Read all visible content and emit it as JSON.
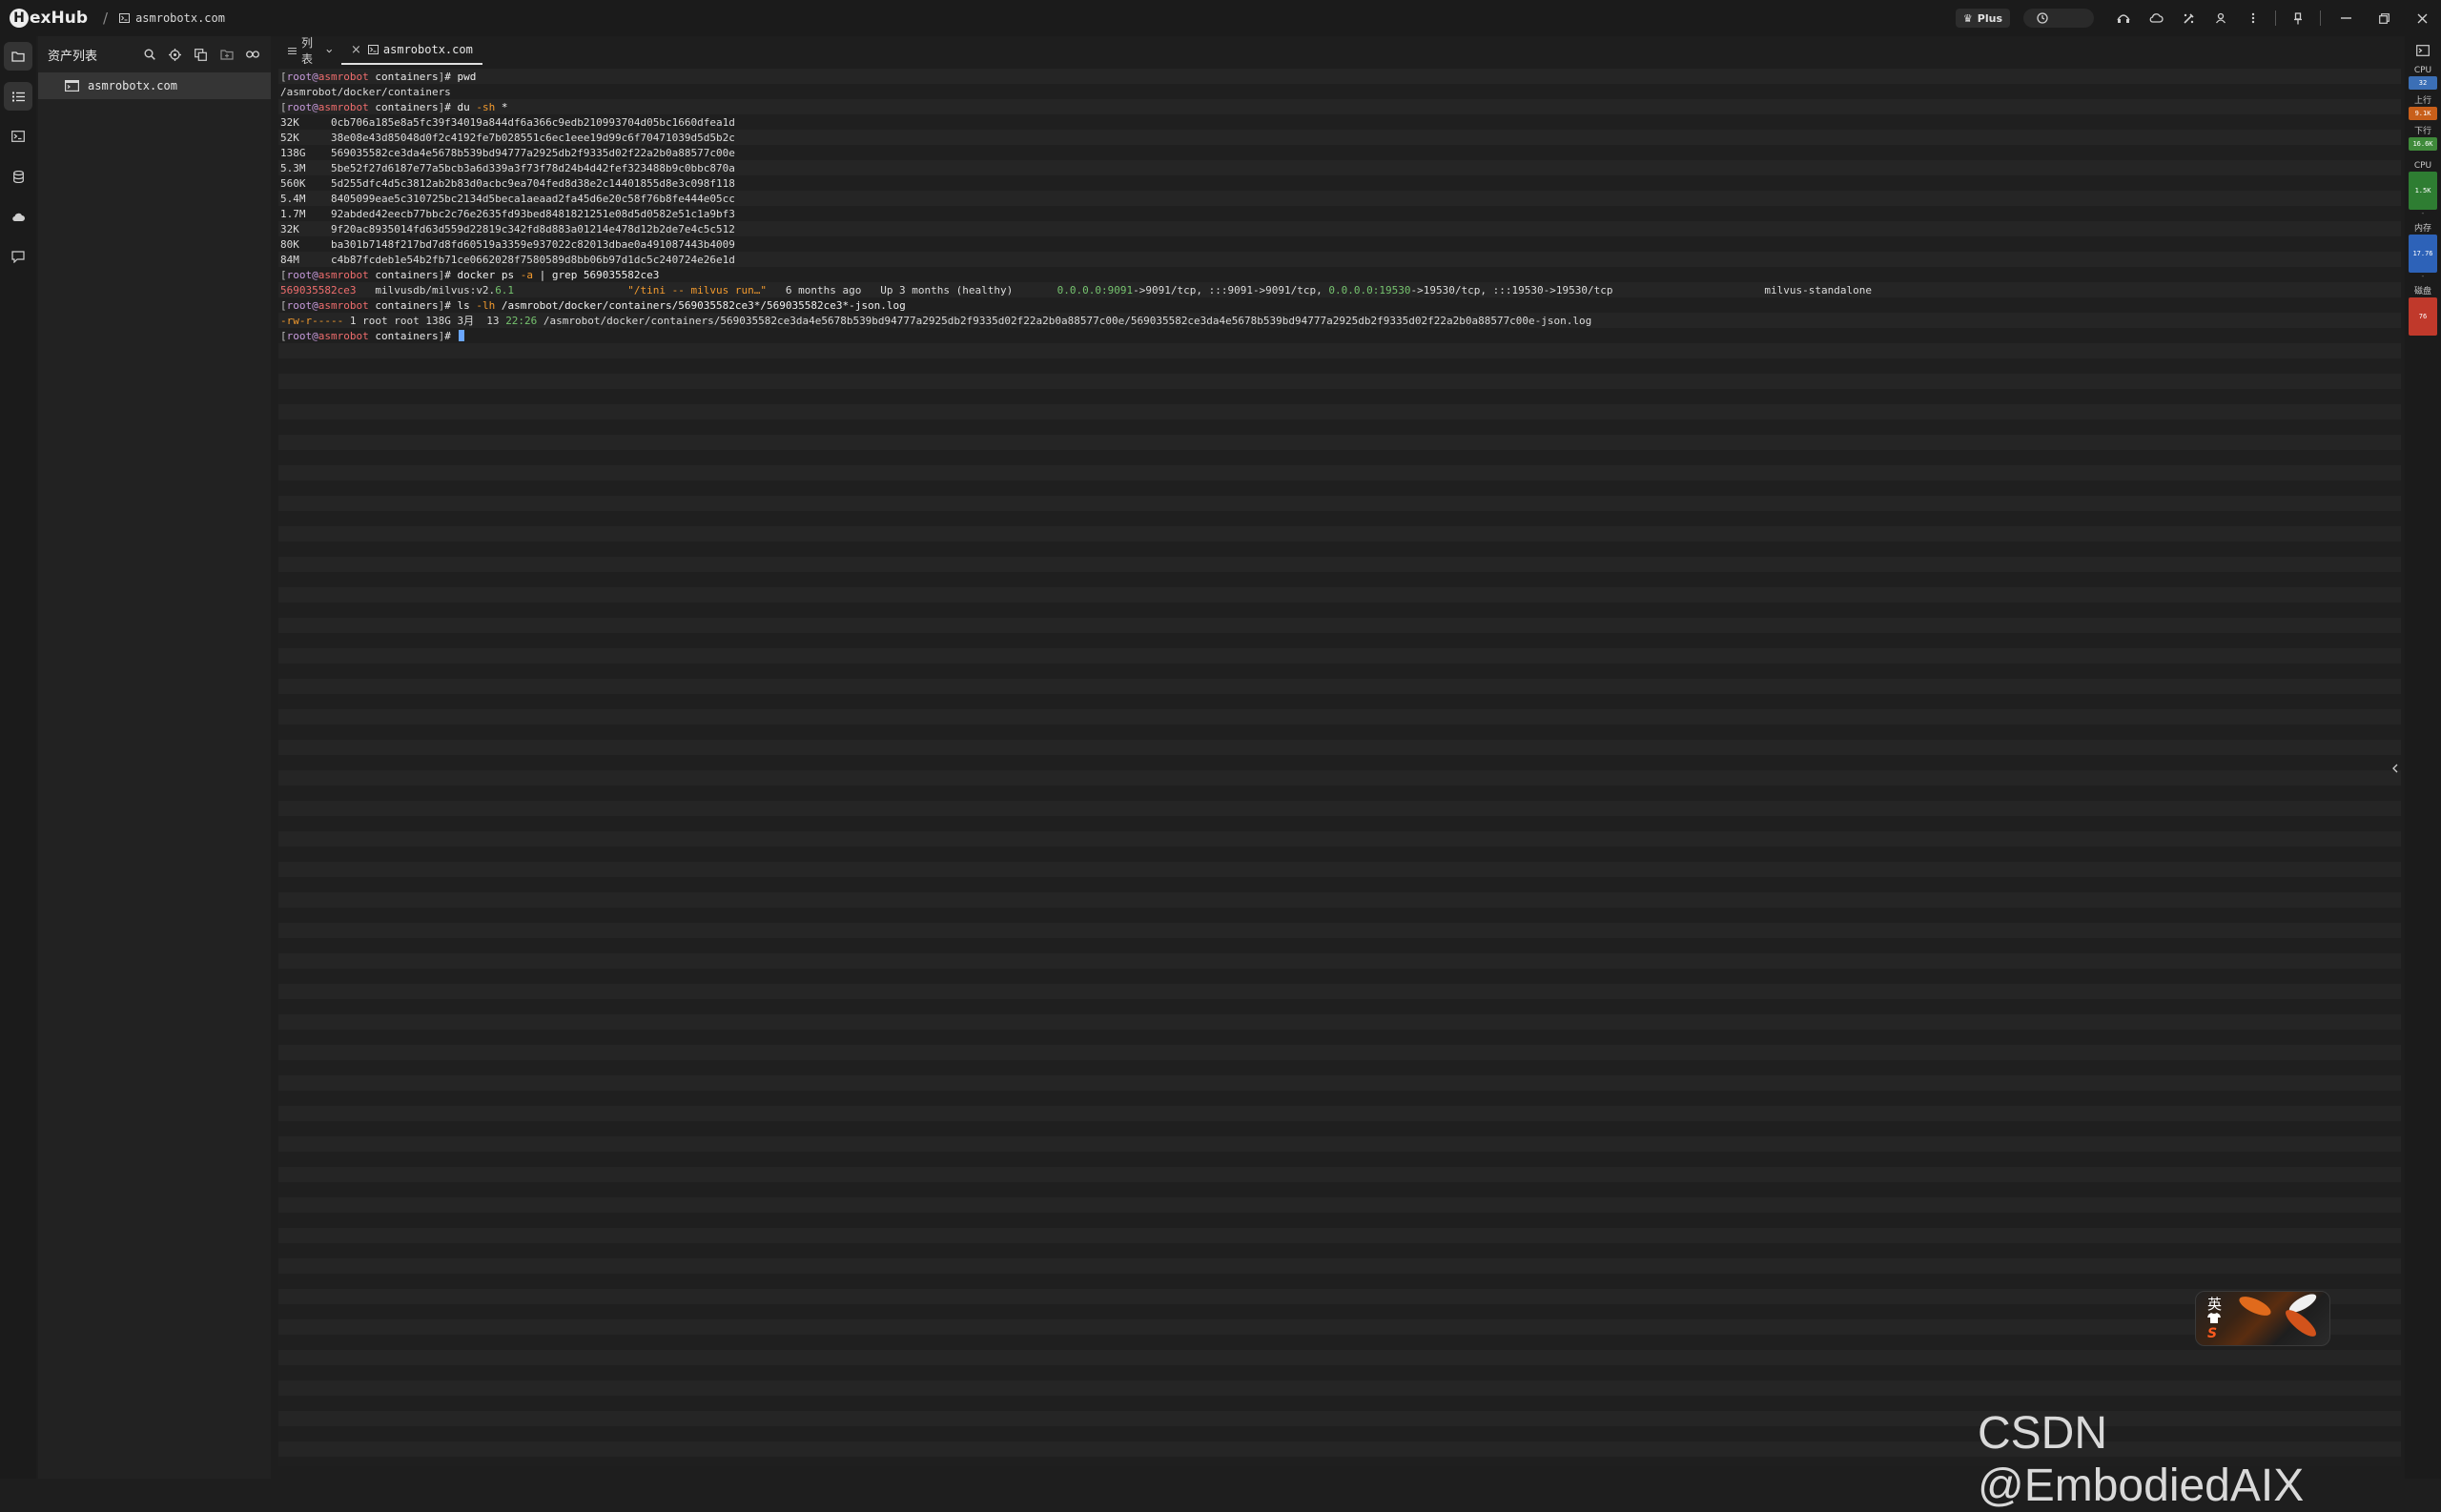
{
  "app": {
    "logo_letter": "H",
    "logo_rest": "exHub",
    "breadcrumb_sep": "/",
    "breadcrumb_host": "asmrobotx.com"
  },
  "titlebar": {
    "plus_label": "Plus"
  },
  "assets": {
    "title": "资产列表",
    "items": [
      {
        "label": "asmrobotx.com"
      }
    ]
  },
  "tabs": {
    "list_label": "列表",
    "active_label": "asmrobotx.com"
  },
  "terminal": {
    "prompt": {
      "user": "root",
      "at": "@",
      "host": "asmrobot",
      "dir": "containers",
      "symbol": "#"
    },
    "lines": [
      {
        "type": "prompt",
        "segs": [
          {
            "c": "cmd",
            "t": "pwd"
          }
        ]
      },
      {
        "type": "out",
        "segs": [
          {
            "c": "",
            "t": "/asmrobot/docker/containers"
          }
        ]
      },
      {
        "type": "prompt",
        "segs": [
          {
            "c": "cmd",
            "t": "du "
          },
          {
            "c": "flag",
            "t": "-sh"
          },
          {
            "c": "cmd",
            "t": " *"
          }
        ]
      },
      {
        "type": "out",
        "segs": [
          {
            "c": "",
            "t": "32K     0cb706a185e8a5fc39f34019a844df6a366c9edb210993704d05bc1660dfea1d"
          }
        ]
      },
      {
        "type": "out",
        "segs": [
          {
            "c": "",
            "t": "52K     38e08e43d85048d0f2c4192fe7b028551c6ec1eee19d99c6f70471039d5d5b2c"
          }
        ]
      },
      {
        "type": "out",
        "segs": [
          {
            "c": "",
            "t": "138G    569035582ce3da4e5678b539bd94777a2925db2f9335d02f22a2b0a88577c00e"
          }
        ]
      },
      {
        "type": "out",
        "segs": [
          {
            "c": "",
            "t": "5.3M    5be52f27d6187e77a5bcb3a6d339a3f73f78d24b4d42fef323488b9c0bbc870a"
          }
        ]
      },
      {
        "type": "out",
        "segs": [
          {
            "c": "",
            "t": "560K    5d255dfc4d5c3812ab2b83d0acbc9ea704fed8d38e2c14401855d8e3c098f118"
          }
        ]
      },
      {
        "type": "out",
        "segs": [
          {
            "c": "",
            "t": "5.4M    8405099eae5c310725bc2134d5beca1aeaad2fa45d6e20c58f76b8fe444e05cc"
          }
        ]
      },
      {
        "type": "out",
        "segs": [
          {
            "c": "",
            "t": "1.7M    92abded42eecb77bbc2c76e2635fd93bed8481821251e08d5d0582e51c1a9bf3"
          }
        ]
      },
      {
        "type": "out",
        "segs": [
          {
            "c": "",
            "t": "32K     9f20ac8935014fd63d559d22819c342fd8d883a01214e478d12b2de7e4c5c512"
          }
        ]
      },
      {
        "type": "out",
        "segs": [
          {
            "c": "",
            "t": "80K     ba301b7148f217bd7d8fd60519a3359e937022c82013dbae0a491087443b4009"
          }
        ]
      },
      {
        "type": "out",
        "segs": [
          {
            "c": "",
            "t": "84M     c4b87fcdeb1e54b2fb71ce0662028f7580589d8bb06b97d1dc5c240724e26e1d"
          }
        ]
      },
      {
        "type": "prompt",
        "segs": [
          {
            "c": "cmd",
            "t": "docker ps "
          },
          {
            "c": "flag",
            "t": "-a"
          },
          {
            "c": "cmd",
            "t": " | grep 569035582ce3"
          }
        ]
      },
      {
        "type": "out",
        "segs": [
          {
            "c": "red",
            "t": "569035582ce3"
          },
          {
            "c": "",
            "t": "   milvusdb/milvus:v2."
          },
          {
            "c": "green",
            "t": "6.1"
          },
          {
            "c": "",
            "t": "                  "
          },
          {
            "c": "orange",
            "t": "\"/tini -- milvus run…\""
          },
          {
            "c": "",
            "t": "   6 months ago   Up 3 months (healthy)       "
          },
          {
            "c": "green",
            "t": "0.0.0.0:9091"
          },
          {
            "c": "",
            "t": "->9091/tcp, :::9091->9091/tcp, "
          },
          {
            "c": "green",
            "t": "0.0.0.0:19530"
          },
          {
            "c": "",
            "t": "->19530/tcp, :::19530->19530/tcp                        milvus-standalone"
          }
        ]
      },
      {
        "type": "prompt",
        "segs": [
          {
            "c": "cmd",
            "t": "ls "
          },
          {
            "c": "flag",
            "t": "-lh"
          },
          {
            "c": "cmd",
            "t": " /asmrobot/docker/containers/569035582ce3*/569035582ce3*-json.log"
          }
        ]
      },
      {
        "type": "out",
        "segs": [
          {
            "c": "orange",
            "t": "-rw-r-----"
          },
          {
            "c": "",
            "t": " 1 root root 138G 3月  13 "
          },
          {
            "c": "green",
            "t": "22:26"
          },
          {
            "c": "",
            "t": " /asmrobot/docker/containers/569035582ce3da4e5678b539bd94777a2925db2f9335d02f22a2b0a88577c00e/569035582ce3da4e5678b539bd94777a2925db2f9335d02f22a2b0a88577c00e-json.log"
          }
        ]
      },
      {
        "type": "prompt_cursor",
        "segs": []
      }
    ]
  },
  "monitor": {
    "cpu_label": "CPU",
    "cpu_value": "32",
    "up_label": "上行",
    "up_value": "9.1K",
    "down_label": "下行",
    "down_value": "16.6K",
    "cpu2_label": "CPU",
    "cpu2_value": "1.5K",
    "mem_label": "内存",
    "mem_value": "17.76",
    "disk_label": "磁盘",
    "disk_value": "76",
    "colors": {
      "cpu": "#3b6fb6",
      "up": "#c85f1a",
      "down": "#3f8a3a",
      "cpu2": "#2e7d32",
      "mem": "#2d62b8",
      "disk": "#c0392b"
    }
  },
  "ime": {
    "char": "英",
    "mark": "S"
  },
  "watermark": "CSDN @EmbodiedAIX"
}
